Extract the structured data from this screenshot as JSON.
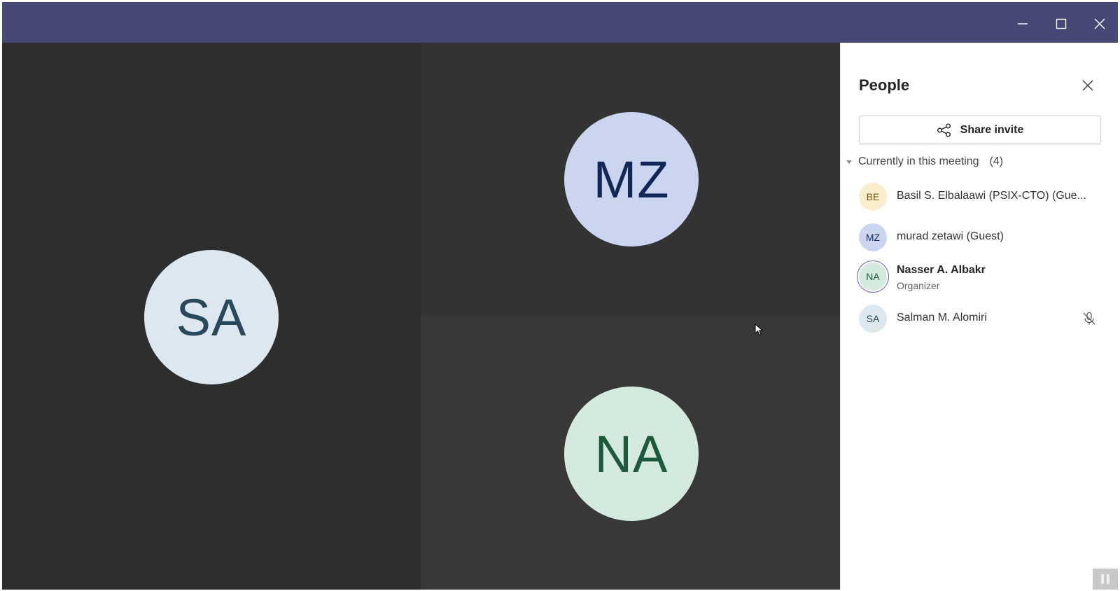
{
  "window": {
    "controls": {
      "minimize_icon": "minimize-icon",
      "maximize_icon": "maximize-icon",
      "close_icon": "close-icon"
    },
    "titlebar_color": "#464775"
  },
  "stage": {
    "tiles": [
      {
        "initials": "SA",
        "color": "#dde7ef"
      },
      {
        "initials": "MZ",
        "color": "#cbd5ef"
      },
      {
        "initials": "NA",
        "color": "#d4eadf"
      }
    ]
  },
  "people_panel": {
    "title": "People",
    "share_invite_label": "Share invite",
    "section": {
      "label": "Currently in this meeting",
      "count": "(4)"
    },
    "participants": [
      {
        "initials": "BE",
        "name": "Basil S. Elbalaawi (PSIX-CTO) (Gue...",
        "color": "#fbeecd"
      },
      {
        "initials": "MZ",
        "name": "murad zetawi (Guest)",
        "color": "#cbd5ef"
      },
      {
        "initials": "NA",
        "name": "Nasser A. Albakr",
        "role": "Organizer",
        "color": "#d4eadf"
      },
      {
        "initials": "SA",
        "name": "Salman M. Alomiri",
        "muted": true,
        "color": "#dde7ef"
      }
    ]
  }
}
